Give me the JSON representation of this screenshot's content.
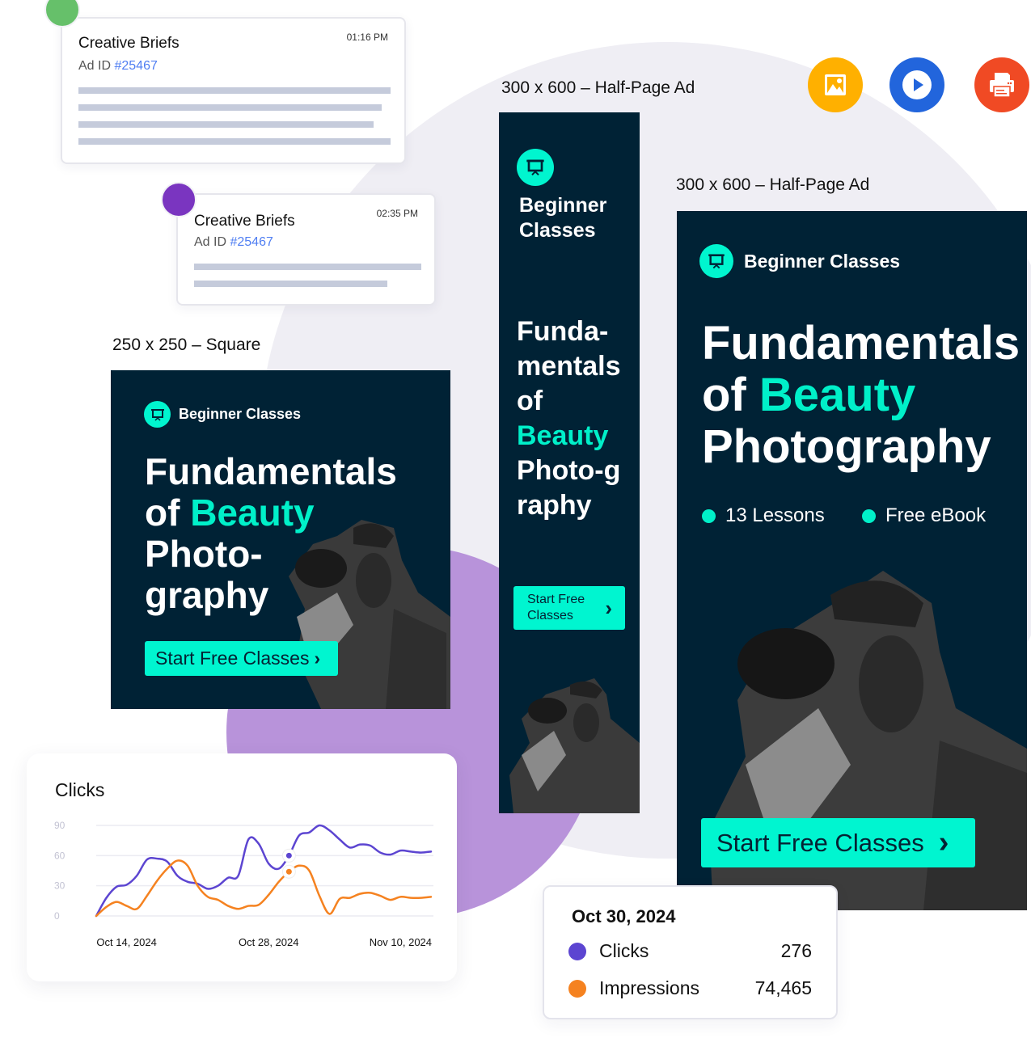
{
  "colors": {
    "ad_background": "#002235",
    "accent_teal": "#00f5d0",
    "clicks_series": "#5c45d1",
    "impressions_series": "#f58220",
    "link_blue": "#4f7ef2",
    "purple_blob": "#b893da",
    "green_dot": "#66c06a",
    "purple_dot": "#7a35c0"
  },
  "briefs": [
    {
      "title": "Creative Briefs",
      "ad_id_label": "Ad ID",
      "ad_id": "#25467",
      "time": "01:16 PM",
      "dot_color": "#66c06a"
    },
    {
      "title": "Creative Briefs",
      "ad_id_label": "Ad ID",
      "ad_id": "#25467",
      "time": "02:35 PM",
      "dot_color": "#7a35c0"
    }
  ],
  "action_icons": [
    {
      "name": "image-icon",
      "color": "#ffb000"
    },
    {
      "name": "play-icon",
      "color": "#2265dc"
    },
    {
      "name": "printer-icon",
      "color": "#f04a24"
    }
  ],
  "ads": {
    "square": {
      "size_label": "250 x 250 – Square",
      "brand": "Beginner Classes",
      "headline": {
        "line1": "Fundamentals",
        "of": "of ",
        "accent": "Beauty",
        "line3": "Photo-",
        "line4": "graphy"
      },
      "cta": "Start Free Classes"
    },
    "skyscraper": {
      "size_label": "300 x 600 – Half-Page Ad",
      "brand_line1": "Beginner",
      "brand_line2": "Classes",
      "headline": {
        "line1": "Funda-",
        "line2": "mentals",
        "line3": "of",
        "accent": "Beauty",
        "line5": "Photo-g",
        "line6": "raphy"
      },
      "cta_line1": "Start Free",
      "cta_line2": "Classes"
    },
    "halfpage": {
      "size_label": "300 x 600 – Half-Page Ad",
      "brand": "Beginner Classes",
      "headline": {
        "line1": "Fundamentals",
        "of": "of ",
        "accent": "Beauty",
        "line3": "Photography"
      },
      "bullets": [
        "13 Lessons",
        "Free eBook"
      ],
      "cta": "Start Free Classes"
    }
  },
  "chart_data": {
    "type": "line",
    "title": "Clicks",
    "xlabel": "",
    "ylabel": "",
    "ylim": [
      0,
      90
    ],
    "yticks": [
      0,
      30,
      60,
      90
    ],
    "xtick_labels": [
      "Oct 14, 2024",
      "Oct 28, 2024",
      "Nov 10, 2024"
    ],
    "x_index_of_xticks": [
      3,
      17,
      30
    ],
    "grid": true,
    "highlight_index": 19,
    "x": [
      "Oct 11",
      "Oct 12",
      "Oct 13",
      "Oct 14",
      "Oct 15",
      "Oct 16",
      "Oct 17",
      "Oct 18",
      "Oct 19",
      "Oct 20",
      "Oct 21",
      "Oct 22",
      "Oct 23",
      "Oct 24",
      "Oct 25",
      "Oct 26",
      "Oct 27",
      "Oct 28",
      "Oct 29",
      "Oct 30",
      "Oct 31",
      "Nov 1",
      "Nov 2",
      "Nov 3",
      "Nov 4",
      "Nov 5",
      "Nov 6",
      "Nov 7",
      "Nov 8",
      "Nov 9",
      "Nov 10",
      "Nov 11",
      "Nov 12",
      "Nov 13"
    ],
    "series": [
      {
        "name": "Clicks",
        "values": [
          0,
          18,
          29,
          31,
          40,
          56,
          57,
          54,
          40,
          34,
          32,
          27,
          30,
          38,
          40,
          76,
          72,
          52,
          47,
          60,
          80,
          83,
          90,
          85,
          76,
          68,
          71,
          70,
          63,
          61,
          65,
          64,
          63,
          64
        ]
      },
      {
        "name": "Impressions",
        "values": [
          0,
          9,
          14,
          10,
          7,
          20,
          35,
          47,
          55,
          50,
          30,
          19,
          16,
          10,
          7,
          10,
          11,
          21,
          34,
          44,
          50,
          45,
          20,
          2,
          17,
          18,
          22,
          23,
          20,
          16,
          19,
          18,
          18,
          19
        ]
      }
    ]
  },
  "tooltip": {
    "date": "Oct 30, 2024",
    "rows": [
      {
        "label": "Clicks",
        "value": "276",
        "color": "#5c45d1"
      },
      {
        "label": "Impressions",
        "value": "74,465",
        "color": "#f58220"
      }
    ]
  }
}
